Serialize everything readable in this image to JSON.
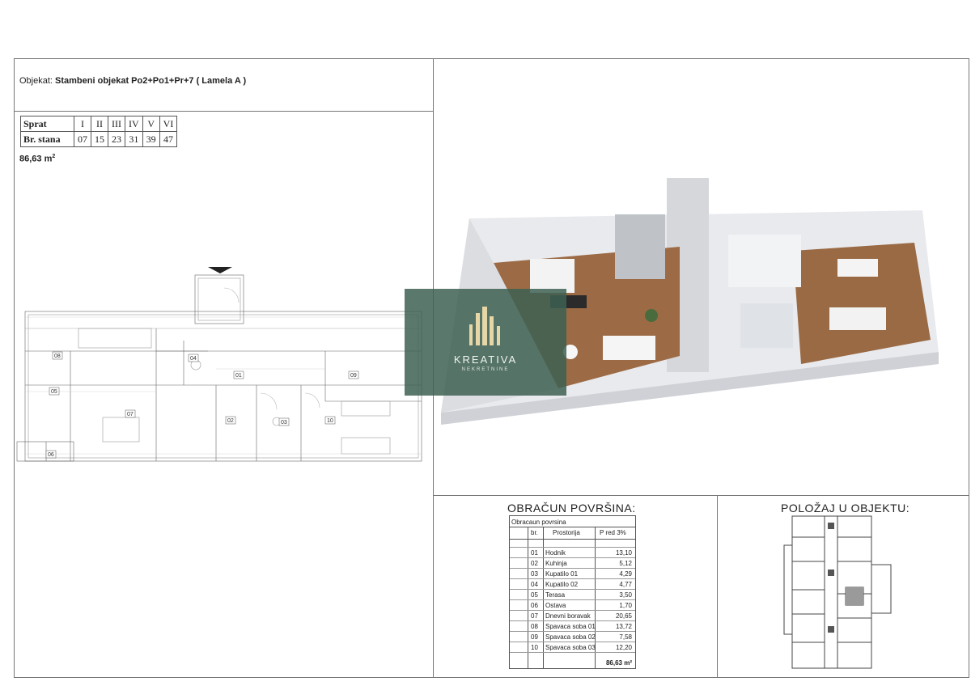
{
  "header": {
    "label": "Objekat:",
    "value": "Stambeni objekat Po2+Po1+Pr+7 ( Lamela A )"
  },
  "floors": {
    "sprat_label": "Sprat",
    "stan_label": "Br. stana",
    "floors": [
      "I",
      "II",
      "III",
      "IV",
      "V",
      "VI"
    ],
    "apartments": [
      "07",
      "15",
      "23",
      "31",
      "39",
      "47"
    ]
  },
  "area": {
    "value": "86,63 m",
    "unit_sup": "2"
  },
  "logo": {
    "name": "KREATIVA",
    "sub": "NEKRETNINE"
  },
  "calc": {
    "title": "OBRAČUN POVRŠINA:",
    "caption": "Obracaun povrsina",
    "col_br": "br.",
    "col_room": "Prostorija",
    "col_area": "P red 3%",
    "rows": [
      {
        "no": "01",
        "room": "Hodnik",
        "area": "13,10"
      },
      {
        "no": "02",
        "room": "Kuhinja",
        "area": "5,12"
      },
      {
        "no": "03",
        "room": "Kupatilo 01",
        "area": "4,29"
      },
      {
        "no": "04",
        "room": "Kupatilo 02",
        "area": "4,77"
      },
      {
        "no": "05",
        "room": "Terasa",
        "area": "3,50"
      },
      {
        "no": "06",
        "room": "Ostava",
        "area": "1,70"
      },
      {
        "no": "07",
        "room": "Dnevni boravak",
        "area": "20,65"
      },
      {
        "no": "08",
        "room": "Spavaca soba 01",
        "area": "13,72"
      },
      {
        "no": "09",
        "room": "Spavaca soba 02",
        "area": "7,58"
      },
      {
        "no": "10",
        "room": "Spavaca soba 03",
        "area": "12,20"
      }
    ],
    "total": "86,63 m²"
  },
  "position": {
    "title": "POLOŽAJ U OBJEKTU:"
  },
  "plan_labels": [
    "01",
    "02",
    "03",
    "04",
    "05",
    "06",
    "07",
    "08",
    "09",
    "10"
  ]
}
